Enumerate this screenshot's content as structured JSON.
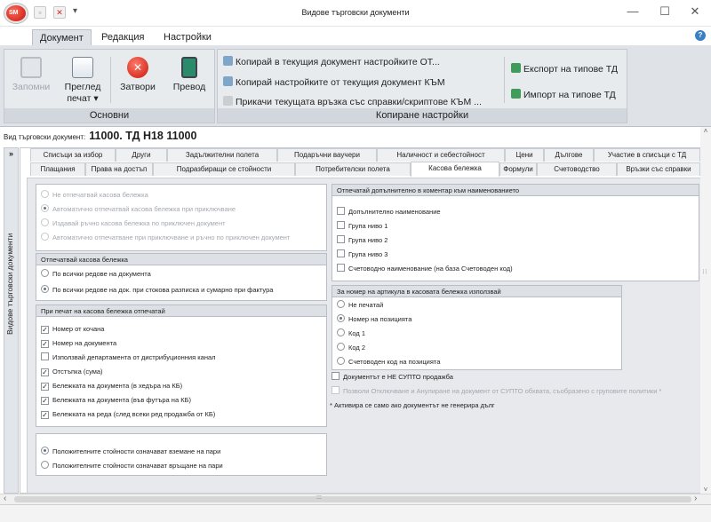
{
  "window": {
    "title": "Видове търговски документи",
    "app_badge": "SM",
    "minimize": "—",
    "maximize": "☐",
    "close": "✕",
    "help": "?"
  },
  "ribbon_tabs": [
    "Документ",
    "Редакция",
    "Настройки"
  ],
  "ribbon": {
    "basic": {
      "label": "Основни",
      "save": "Запомни",
      "preview_line1": "Преглед",
      "preview_line2": "печат ▾",
      "close": "Затвори",
      "translate": "Превод"
    },
    "copy": {
      "label": "Копиране настройки",
      "copy_to": "Копирай в текущия документ настройките ОТ...",
      "copy_from": "Копирай настройките от текущия документ КЪМ",
      "attach": "Прикачи текущата връзка със справки/скриптове КЪМ ...",
      "export": "Експорт на типове ТД",
      "import": "Импорт на типове ТД"
    }
  },
  "doc_line": {
    "label": "Вид търговски документ:",
    "value": "11000. ТД Н18 11000"
  },
  "side_panel": {
    "arrow": "»",
    "title": "Видове търговски документи"
  },
  "tabs_row1": [
    "Списъци за избор",
    "Други",
    "Задължителни полета",
    "Подаръчни ваучери",
    "Наличност и себестойност",
    "Цени",
    "Дългове",
    "Участие в списъци с ТД"
  ],
  "tabs_row2": [
    "Плащания",
    "Права на достъп",
    "Подразбиращи се стойности",
    "Потребителски полета",
    "Касова бележка",
    "Формули",
    "Счетоводство",
    "Връзки със справки"
  ],
  "active_tab": "Касова бележка",
  "receipt_mode": {
    "options": [
      {
        "label": "Не отпечатвай касова бележка",
        "checked": false
      },
      {
        "label": "Автоматично отпечатвай касова бележка при приключване",
        "checked": true
      },
      {
        "label": "Издавай ръчно касова бележка по приключен документ",
        "checked": false
      },
      {
        "label": "Автоматично отпечатване при приключване и ръчно по приключен документ",
        "checked": false
      }
    ]
  },
  "print_receipt": {
    "title": "Отпечатвай касова бележка",
    "options": [
      {
        "label": "По всички редове на документа",
        "checked": false
      },
      {
        "label": "По всички редове на док. при стокова разписка и сумарно при фактура",
        "checked": true
      }
    ]
  },
  "print_options": {
    "title": "При печат на касова бележка отпечатай",
    "items": [
      {
        "label": "Номер от кочана",
        "checked": true
      },
      {
        "label": "Номер на документа",
        "checked": true
      },
      {
        "label": "Използвай департамента от дистрибуционния канал",
        "checked": false
      },
      {
        "label": "Отстъпка (сума)",
        "checked": true
      },
      {
        "label": "Бележката на документа (в хедъра на КБ)",
        "checked": true
      },
      {
        "label": "Бележката на документа (във футъра на КБ)",
        "checked": true
      },
      {
        "label": "Бележката на реда (след всеки ред продажба от КБ)",
        "checked": true
      }
    ]
  },
  "sign_options": [
    {
      "label": "Положителните стойности означават вземане на пари",
      "checked": true
    },
    {
      "label": "Положителните стойности означават връщане на пари",
      "checked": false
    }
  ],
  "extra_print": {
    "title": "Отпечатай допълнително в коментар към наименованието",
    "items": [
      {
        "label": "Допълнително наименование",
        "checked": false
      },
      {
        "label": "Група ниво 1",
        "checked": false
      },
      {
        "label": "Група ниво 2",
        "checked": false
      },
      {
        "label": "Група ниво 3",
        "checked": false
      },
      {
        "label": "Счетоводно наименование (на база Счетоводен код)",
        "checked": false
      }
    ]
  },
  "article_number": {
    "title": "За номер на артикула в касовата бележка използвай",
    "options": [
      {
        "label": "Не печатай",
        "checked": false
      },
      {
        "label": "Номер на позицията",
        "checked": true
      },
      {
        "label": "Код 1",
        "checked": false
      },
      {
        "label": "Код 2",
        "checked": false
      },
      {
        "label": "Счетоводен код на позицията",
        "checked": false
      }
    ]
  },
  "not_supto": {
    "label": "Документът е НЕ СУПТО продажба",
    "checked": false
  },
  "allow_cancel": {
    "label": "Позволи Отключване и Анулиране на документ от СУПТО обхвата, съобразено с груповите политики *",
    "checked": false
  },
  "note": "* Активира се само ако документът не генерира дълг",
  "scroll": {
    "left": "‹",
    "right": "›",
    "up": "˄",
    "down": "˅",
    "grip": ":::"
  },
  "colors": {
    "ribbon_bg": "#dfe3e8",
    "accent_red": "#d9291c",
    "header_bg": "#dde1e6"
  }
}
